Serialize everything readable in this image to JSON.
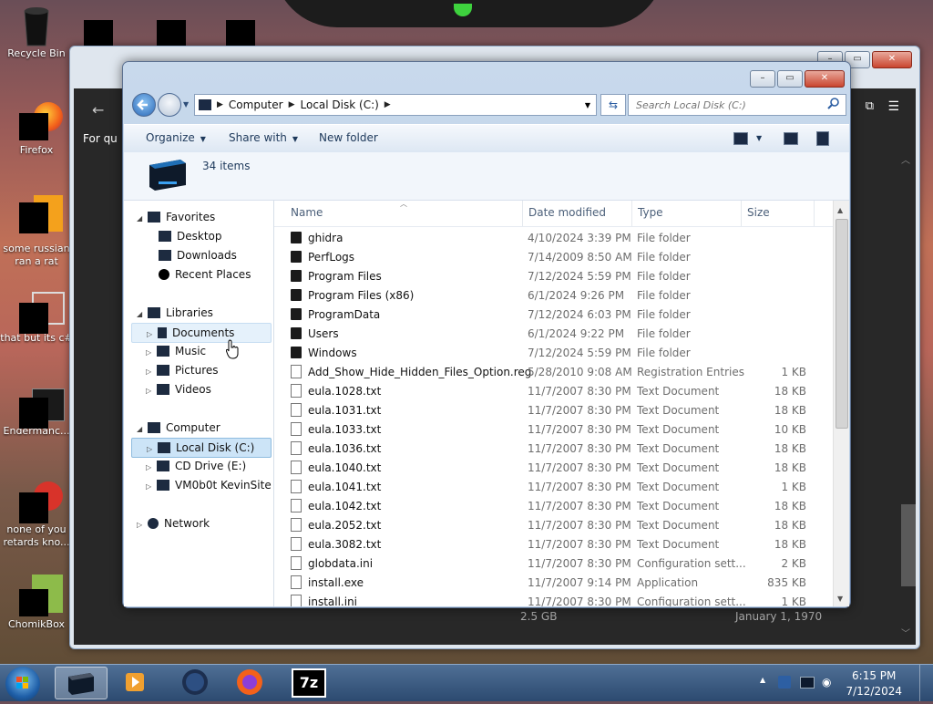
{
  "desktop": {
    "icons": [
      {
        "label": "Recycle Bin"
      },
      {
        "label": "Firefox"
      },
      {
        "label": "some russian ran a rat"
      },
      {
        "label": "that but its c#"
      },
      {
        "label": "Endermanc..."
      },
      {
        "label": "none of you retards kno..."
      },
      {
        "label": "ChomikBox"
      }
    ]
  },
  "background_window": {
    "snippet_left": "For qu",
    "bottom_row_size": "2.5 GB",
    "bottom_row_date": "January 1, 1970"
  },
  "explorer": {
    "breadcrumb": [
      "Computer",
      "Local Disk (C:)"
    ],
    "search_placeholder": "Search Local Disk (C:)",
    "toolbar": {
      "organize": "Organize",
      "share_with": "Share with",
      "new_folder": "New folder"
    },
    "details": {
      "count": "34 items"
    },
    "nav": {
      "favorites": "Favorites",
      "desktop": "Desktop",
      "downloads": "Downloads",
      "recent_places": "Recent Places",
      "libraries": "Libraries",
      "documents": "Documents",
      "music": "Music",
      "pictures": "Pictures",
      "videos": "Videos",
      "computer": "Computer",
      "local_disk": "Local Disk (C:)",
      "cd_drive": "CD Drive (E:)",
      "vm_share": "VM0b0t KevinSite",
      "network": "Network"
    },
    "columns": {
      "name": "Name",
      "date": "Date modified",
      "type": "Type",
      "size": "Size"
    },
    "files": [
      {
        "name": "ghidra",
        "date": "4/10/2024 3:39 PM",
        "type": "File folder",
        "size": "",
        "kind": "folder"
      },
      {
        "name": "PerfLogs",
        "date": "7/14/2009 8:50 AM",
        "type": "File folder",
        "size": "",
        "kind": "folder"
      },
      {
        "name": "Program Files",
        "date": "7/12/2024 5:59 PM",
        "type": "File folder",
        "size": "",
        "kind": "folder"
      },
      {
        "name": "Program Files (x86)",
        "date": "6/1/2024 9:26 PM",
        "type": "File folder",
        "size": "",
        "kind": "folder"
      },
      {
        "name": "ProgramData",
        "date": "7/12/2024 6:03 PM",
        "type": "File folder",
        "size": "",
        "kind": "folder"
      },
      {
        "name": "Users",
        "date": "6/1/2024 9:22 PM",
        "type": "File folder",
        "size": "",
        "kind": "folder"
      },
      {
        "name": "Windows",
        "date": "7/12/2024 5:59 PM",
        "type": "File folder",
        "size": "",
        "kind": "folder"
      },
      {
        "name": "Add_Show_Hide_Hidden_Files_Option.reg",
        "date": "5/28/2010 9:08 AM",
        "type": "Registration Entries",
        "size": "1 KB",
        "kind": "reg"
      },
      {
        "name": "eula.1028.txt",
        "date": "11/7/2007 8:30 PM",
        "type": "Text Document",
        "size": "18 KB",
        "kind": "doc"
      },
      {
        "name": "eula.1031.txt",
        "date": "11/7/2007 8:30 PM",
        "type": "Text Document",
        "size": "18 KB",
        "kind": "doc"
      },
      {
        "name": "eula.1033.txt",
        "date": "11/7/2007 8:30 PM",
        "type": "Text Document",
        "size": "10 KB",
        "kind": "doc"
      },
      {
        "name": "eula.1036.txt",
        "date": "11/7/2007 8:30 PM",
        "type": "Text Document",
        "size": "18 KB",
        "kind": "doc"
      },
      {
        "name": "eula.1040.txt",
        "date": "11/7/2007 8:30 PM",
        "type": "Text Document",
        "size": "18 KB",
        "kind": "doc"
      },
      {
        "name": "eula.1041.txt",
        "date": "11/7/2007 8:30 PM",
        "type": "Text Document",
        "size": "1 KB",
        "kind": "doc"
      },
      {
        "name": "eula.1042.txt",
        "date": "11/7/2007 8:30 PM",
        "type": "Text Document",
        "size": "18 KB",
        "kind": "doc"
      },
      {
        "name": "eula.2052.txt",
        "date": "11/7/2007 8:30 PM",
        "type": "Text Document",
        "size": "18 KB",
        "kind": "doc"
      },
      {
        "name": "eula.3082.txt",
        "date": "11/7/2007 8:30 PM",
        "type": "Text Document",
        "size": "18 KB",
        "kind": "doc"
      },
      {
        "name": "globdata.ini",
        "date": "11/7/2007 8:30 PM",
        "type": "Configuration sett...",
        "size": "2 KB",
        "kind": "doc"
      },
      {
        "name": "install.exe",
        "date": "11/7/2007 9:14 PM",
        "type": "Application",
        "size": "835 KB",
        "kind": "exe"
      },
      {
        "name": "install.ini",
        "date": "11/7/2007 8:30 PM",
        "type": "Configuration sett...",
        "size": "1 KB",
        "kind": "doc"
      }
    ]
  },
  "taskbar": {
    "apps": [
      "explorer",
      "media-player",
      "vpn",
      "firefox",
      "7-zip"
    ],
    "sevenzip_label": "7z",
    "time": "6:15 PM",
    "date": "7/12/2024"
  },
  "colors": {
    "accent": "#2d5fa3",
    "selection": "#cce4f7",
    "taskbar": "#3b5b82"
  }
}
